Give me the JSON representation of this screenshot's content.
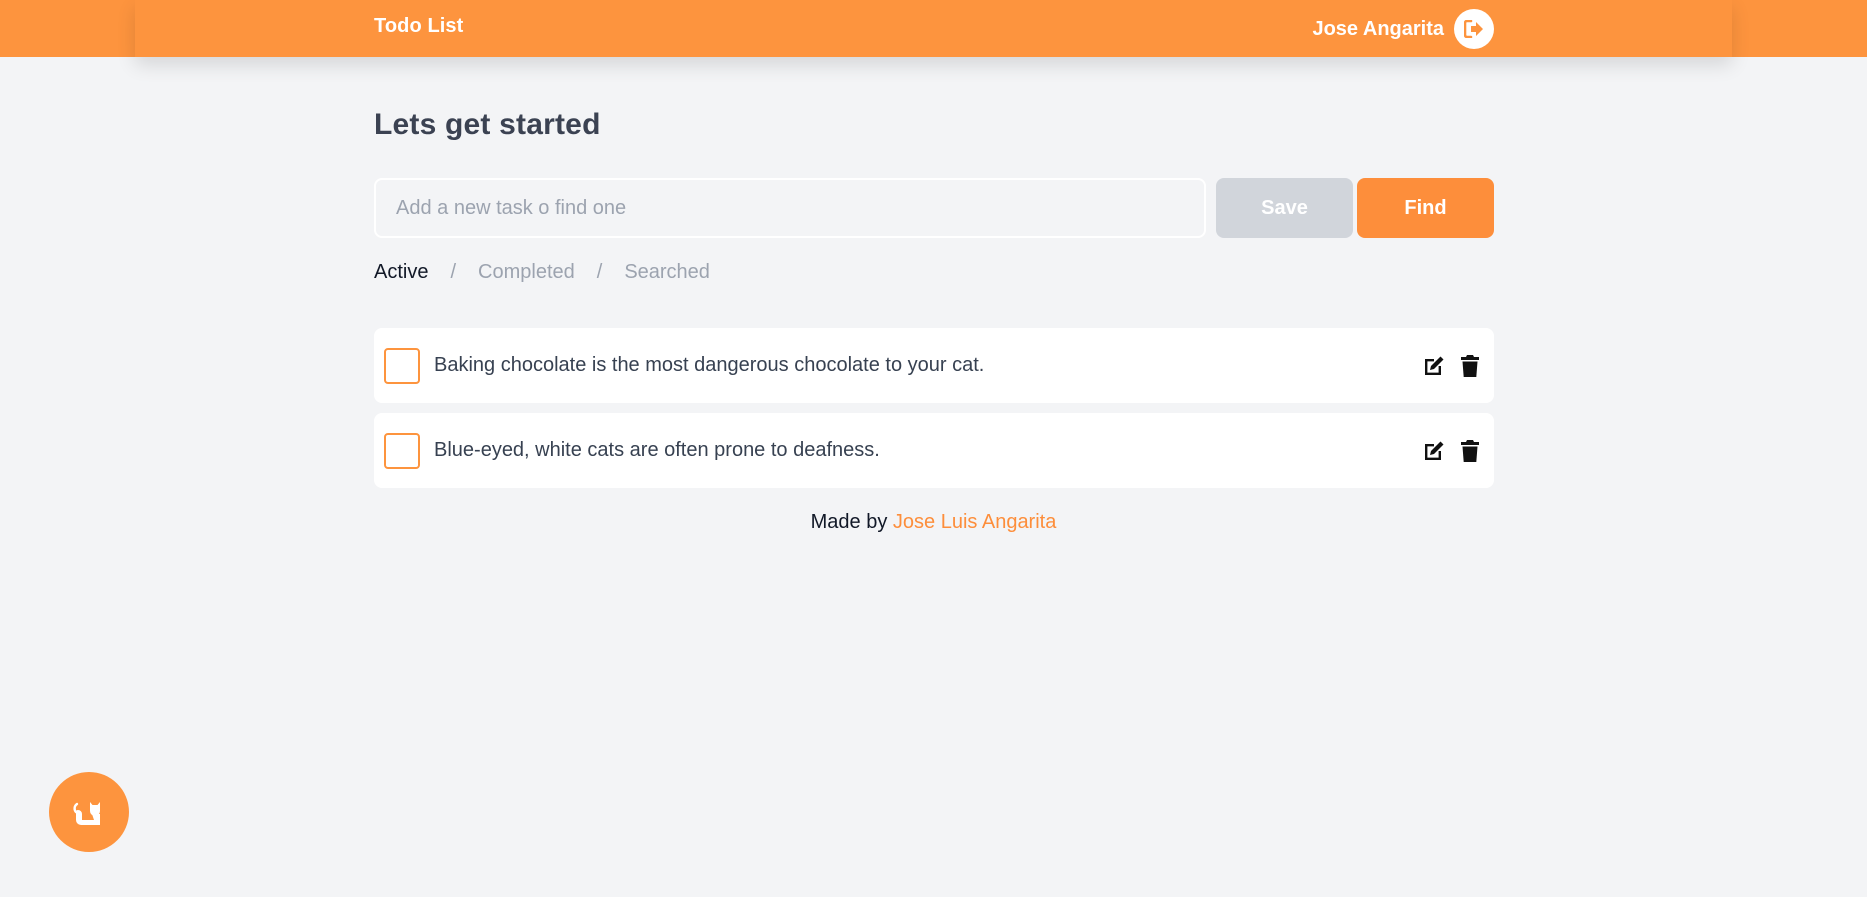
{
  "header": {
    "app_title": "Todo List",
    "user_name": "Jose Angarita",
    "logout_icon": "sign-out-icon"
  },
  "main": {
    "title": "Lets get started",
    "input_placeholder": "Add a new task o find one",
    "input_value": "",
    "save_label": "Save",
    "find_label": "Find"
  },
  "tabs": [
    {
      "label": "Active",
      "active": true
    },
    {
      "label": "/"
    },
    {
      "label": "Completed"
    },
    {
      "label": "/"
    },
    {
      "label": "Searched"
    }
  ],
  "tasks": [
    {
      "text": "Baking chocolate is the most dangerous chocolate to your cat.",
      "completed": false
    },
    {
      "text": "Blue-eyed, white cats are often prone to deafness.",
      "completed": false
    }
  ],
  "footer": {
    "prefix": "Made by",
    "author": "Jose Luis Angarita"
  },
  "colors": {
    "accent": "#fd943e",
    "background": "#f3f4f6",
    "save_disabled": "#d1d5db"
  },
  "fab": {
    "icon": "cat-icon"
  }
}
